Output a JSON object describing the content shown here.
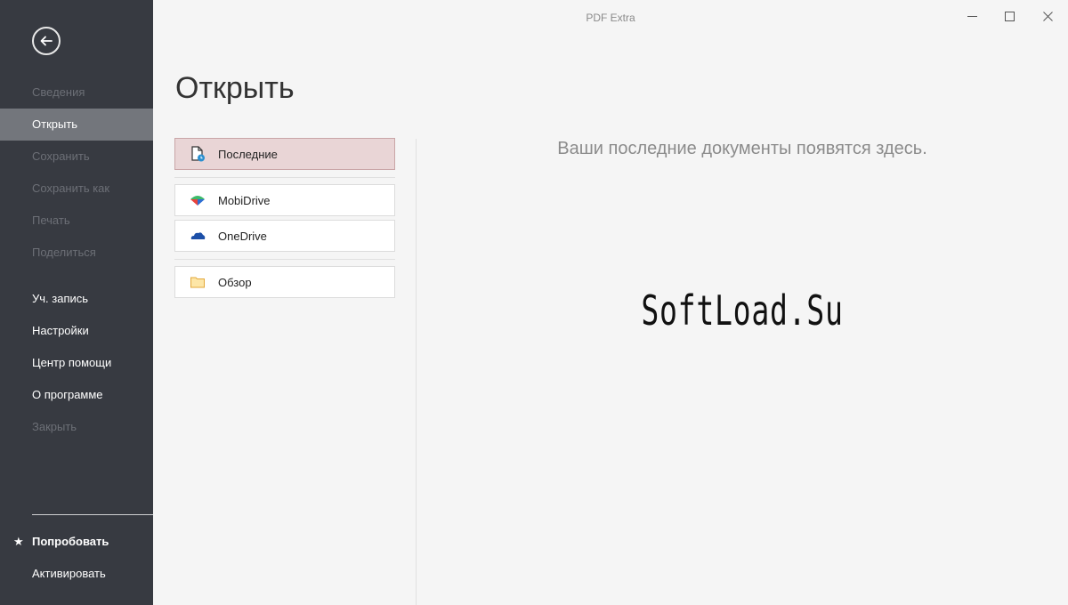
{
  "window": {
    "title": "PDF Extra"
  },
  "sidebar": {
    "items": [
      {
        "label": "Сведения",
        "state": "disabled"
      },
      {
        "label": "Открыть",
        "state": "active"
      },
      {
        "label": "Сохранить",
        "state": "disabled"
      },
      {
        "label": "Сохранить как",
        "state": "disabled"
      },
      {
        "label": "Печать",
        "state": "disabled"
      },
      {
        "label": "Поделиться",
        "state": "disabled"
      },
      {
        "label": "Уч. запись",
        "state": "enabled"
      },
      {
        "label": "Настройки",
        "state": "enabled"
      },
      {
        "label": "Центр помощи",
        "state": "enabled"
      },
      {
        "label": "О программе",
        "state": "enabled"
      },
      {
        "label": "Закрыть",
        "state": "disabled"
      }
    ],
    "bottom": {
      "try_icon": "★",
      "try_label": "Попробовать",
      "activate_label": "Активировать"
    }
  },
  "main": {
    "heading": "Открыть",
    "locations": [
      {
        "label": "Последние",
        "icon": "recent-document-icon"
      },
      {
        "label": "MobiDrive",
        "icon": "mobidrive-icon"
      },
      {
        "label": "OneDrive",
        "icon": "onedrive-cloud-icon"
      },
      {
        "label": "Обзор",
        "icon": "folder-icon"
      }
    ],
    "empty_message": "Ваши последние документы появятся здесь.",
    "watermark": "SoftLoad.Su"
  },
  "colors": {
    "sidebar_bg": "#373a41",
    "sidebar_active": "#73767c",
    "selected_location": "#e9d5d6"
  }
}
